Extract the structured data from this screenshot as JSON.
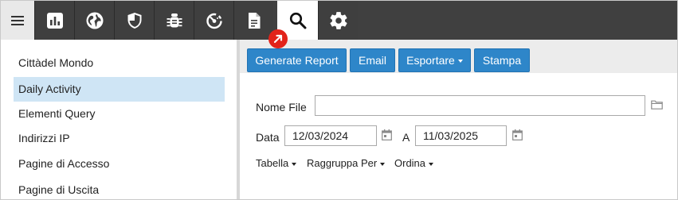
{
  "toolbar": {
    "menu_icon": "hamburger-menu-icon",
    "tabs": [
      {
        "icon": "bar-chart-icon"
      },
      {
        "icon": "globe-icon"
      },
      {
        "icon": "shield-icon"
      },
      {
        "icon": "bug-icon"
      },
      {
        "icon": "dashboard-gauge-icon"
      },
      {
        "icon": "document-icon"
      },
      {
        "icon": "search-icon",
        "active": true
      },
      {
        "icon": "gear-icon"
      }
    ],
    "badge_icon": "external-link-arrow-icon"
  },
  "sidebar": {
    "items": [
      {
        "label": "Cittàdel Mondo"
      },
      {
        "label": "Daily Activity",
        "selected": true
      },
      {
        "label": "Elementi Query"
      },
      {
        "label": "Indirizzi IP"
      },
      {
        "label": "Pagine di Accesso"
      },
      {
        "label": "Pagine di Uscita"
      }
    ]
  },
  "actions": {
    "generate_report": "Generate Report",
    "email": "Email",
    "export": "Esportare",
    "print": "Stampa"
  },
  "form": {
    "file_name_label": "Nome File",
    "file_name_value": "",
    "date_label": "Data",
    "date_from": "12/03/2024",
    "to_label": "A",
    "date_to": "11/03/2025"
  },
  "options": {
    "table": "Tabella",
    "group_by": "Raggruppa Per",
    "order": "Ordina"
  },
  "colors": {
    "toolbar_bg": "#404040",
    "accent_button": "#2e86c9",
    "selected_item": "#cfe5f5",
    "badge": "#e2231a"
  }
}
